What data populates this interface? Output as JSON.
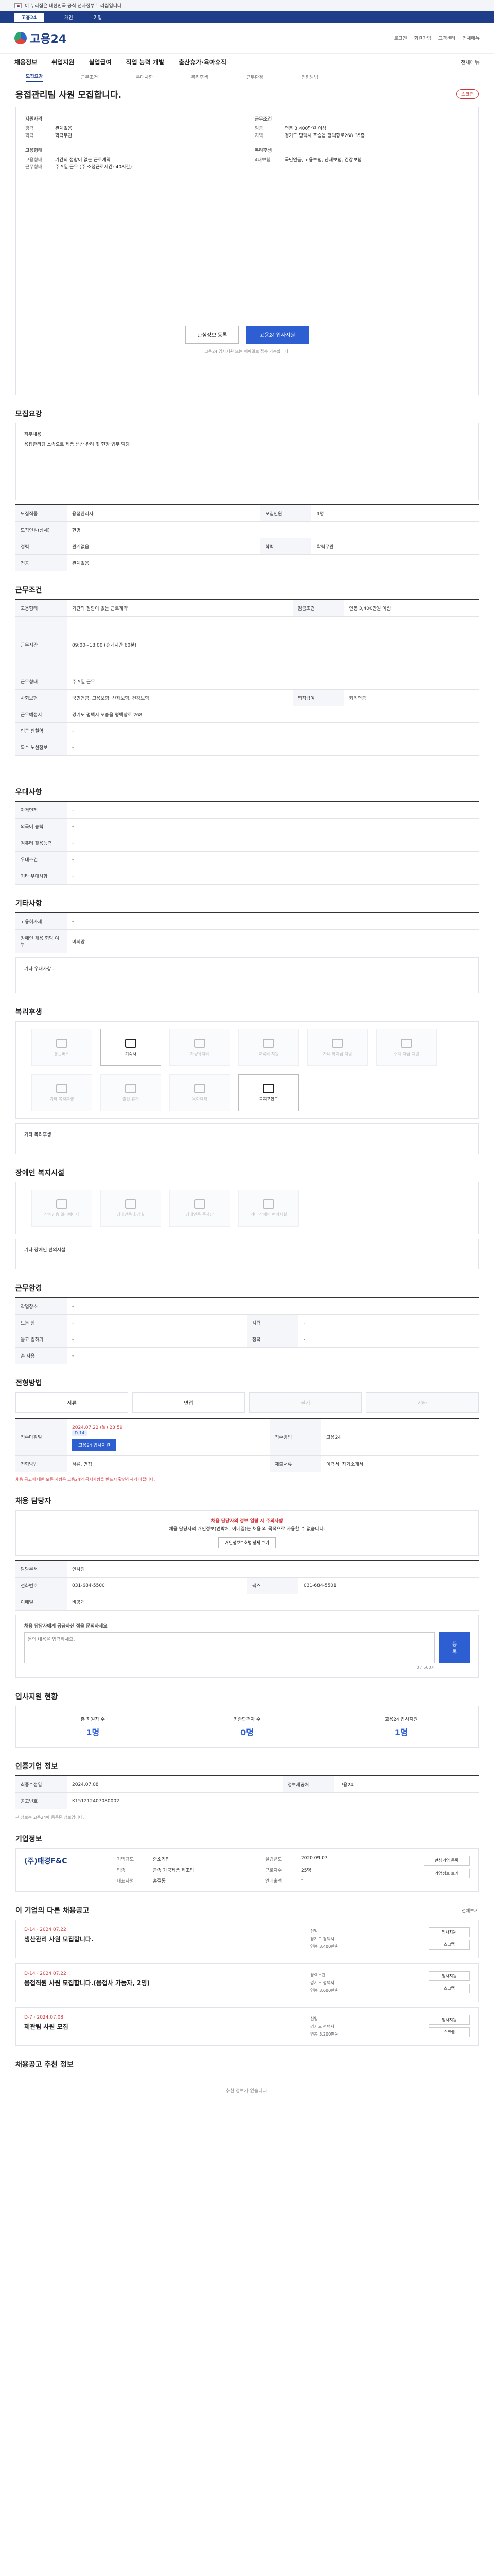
{
  "gov_banner": {
    "text": "이 누리집은 대한민국 공식 전자정부 누리집입니다."
  },
  "site_tabs": [
    "고용24",
    "개인",
    "기업"
  ],
  "header": {
    "logo": "고용24",
    "links": [
      "로그인",
      "회원가입",
      "고객센터",
      "전체메뉴"
    ]
  },
  "gnb": {
    "items": [
      "채용정보",
      "취업지원",
      "실업급여",
      "직업 능력 개발",
      "출산휴가·육아휴직"
    ],
    "right": "전체메뉴"
  },
  "subnav": {
    "items": [
      "모집요강",
      "근무조건",
      "우대사항",
      "복리후생",
      "근무환경",
      "전형방법"
    ],
    "active": 0
  },
  "job": {
    "title": "용접관리팀 사원 모집합니다.",
    "scrap": "스크랩",
    "company_h": "지원자격",
    "left": [
      [
        "경력",
        "관계없음"
      ],
      [
        "학력",
        "학력무관"
      ]
    ],
    "company_right_h": "근무조건",
    "right": [
      [
        "임금",
        "연봉 3,400만원 이상"
      ],
      [
        "지역",
        "경기도 평택시 포승읍 평택항로268 35층"
      ]
    ],
    "emp_h": "고용형태",
    "emp": [
      [
        "고용형태",
        "기간의 정함이 없는 근로계약"
      ],
      [
        "근무형태",
        "주 5일 근무 (주 소정근로시간: 40시간)"
      ]
    ],
    "benefits_h": "복리후생",
    "benefits": [
      [
        "4대보험",
        "국민연금, 고용보험, 산재보험, 건강보험"
      ]
    ],
    "btn_scrap": "관심정보 등록",
    "btn_apply": "고용24 입사지원",
    "note": "고용24 입사지원 또는 이메일로 접수 가능합니다."
  },
  "recruit": {
    "title": "모집요강",
    "duty_h": "직무내용",
    "duty": "용접관리팀 소속으로 제품 생산 관리 및 현장 업무 담당",
    "rows": [
      [
        "모집직종",
        "용접관리자"
      ],
      [
        "모집인원",
        "1명"
      ],
      [
        "모집인원(상세)",
        "한명"
      ],
      [
        "경력",
        "관계없음"
      ],
      [
        "학력",
        "학력무관"
      ],
      [
        "전공",
        "관계없음"
      ]
    ]
  },
  "work": {
    "title": "근무조건",
    "rows": [
      [
        "고용형태",
        "기간의 정함이 없는 근로계약"
      ],
      [
        "임금조건",
        "연봉 3,400만원 이상"
      ],
      [
        "근무시간",
        "주 소정근로시간 40시간"
      ],
      [
        "근무형태",
        "주 5일 근무"
      ],
      [
        "사회보험",
        "국민연금, 고용보험, 산재보험, 건강보험"
      ],
      [
        "퇴직급여",
        "퇴직연금"
      ],
      [
        "근무예정지",
        "경기도 평택시 포승읍 평택항로 268"
      ],
      [
        "인근 전철역",
        "-"
      ],
      [
        "복수 노선정보",
        "-"
      ]
    ],
    "detail": "09:00~18:00 (휴게시간 60분)"
  },
  "prefer": {
    "title": "우대사항",
    "rows": [
      [
        "자격면허",
        "-"
      ],
      [
        "외국어 능력",
        "-"
      ],
      [
        "컴퓨터 활용능력",
        "-"
      ],
      [
        "우대조건",
        "-"
      ],
      [
        "기타 우대사항",
        "-"
      ]
    ]
  },
  "skills": {
    "title": "기타사항",
    "rows": [
      [
        "고용허가제",
        "-"
      ],
      [
        "장애인 채용 희망 여부",
        "비희망"
      ]
    ],
    "note": "기타 우대사항 -"
  },
  "welfare": {
    "title": "복리후생",
    "tiles": [
      "통근버스",
      "기숙사",
      "차량유지비",
      "교육비 지원",
      "자녀 학자금 지원",
      "주택 자금 지원",
      "기타 복리후생",
      "출산 휴가",
      "육아휴직",
      "복지포인트"
    ],
    "active": [
      1,
      9
    ],
    "extra_h": "기타 복리후생"
  },
  "disabled": {
    "title": "장애인 복지시설",
    "tiles": [
      "장애인용 엘리베이터",
      "장애인용 화장실",
      "장애인용 주차장",
      "기타 장애인 편의시설"
    ],
    "extra_h": "기타 장애인 편의시설"
  },
  "env": {
    "title": "근무환경",
    "rows": [
      [
        "작업장소",
        "-"
      ],
      [
        "드는 힘",
        "-"
      ],
      [
        "들고 일하기",
        "-"
      ],
      [
        "손 사용",
        "-"
      ],
      [
        "시력",
        "-"
      ],
      [
        "청력",
        "-"
      ]
    ]
  },
  "process": {
    "title": "전형방법",
    "steps": [
      "서류",
      "면접",
      "필기",
      "기타"
    ],
    "active": [
      0,
      1
    ],
    "rows": [
      [
        "접수마감일",
        "2024.07.22 (월) 23:59"
      ],
      [
        "접수방법",
        "고용24"
      ],
      [
        "전형방법",
        "서류, 면접"
      ],
      [
        "제출서류",
        "이력서, 자기소개서"
      ]
    ],
    "deadline_badge": "D-14",
    "apply_btn": "고용24 입사지원",
    "note": "채용 공고에 대한 모든 사항은 고용24의 공지사항을 반드시 확인하시기 바랍니다."
  },
  "manager": {
    "title": "채용 담당자",
    "alert_head": "채용 담당자의 정보 열람 시 주의사항",
    "alert_body": "채용 담당자의 개인정보(연락처, 이메일)는 채용 외 목적으로 사용할 수 없습니다.",
    "alert_btn": "개인정보보호법 상세 보기",
    "rows": [
      [
        "담당부서",
        "인사팀"
      ],
      [
        "전화번호",
        "031-684-5500"
      ],
      [
        "팩스",
        "031-684-5501"
      ],
      [
        "이메일",
        "비공개"
      ]
    ],
    "inquiry_h": "채용 담당자에게 궁금하신 점을 문의하세요",
    "inquiry_placeholder": "문의 내용을 입력하세요.",
    "inquiry_btn": "등록",
    "inquiry_count": "0 / 500자"
  },
  "status": {
    "title": "입사지원 현황",
    "stats": [
      [
        "총 지원자 수",
        "1명"
      ],
      [
        "최종합격자 수",
        "0명"
      ],
      [
        "고용24 입사지원",
        "1명"
      ]
    ]
  },
  "info": {
    "title": "인증기업 정보",
    "rows": [
      [
        "최종수정일",
        "2024.07.08"
      ],
      [
        "공고번호",
        "K151212407080002"
      ],
      [
        "정보제공처",
        "고용24"
      ]
    ],
    "note": "본 정보는 고용24에 등록된 정보입니다."
  },
  "company": {
    "title": "기업정보",
    "name": "(주)태경F&C",
    "rows": [
      [
        "기업규모",
        "중소기업"
      ],
      [
        "업종",
        "금속 가공제품 제조업"
      ],
      [
        "대표자명",
        "홍길동"
      ],
      [
        "설립년도",
        "2020.09.07"
      ],
      [
        "근로자수",
        "25명"
      ],
      [
        "연매출액",
        "-"
      ]
    ],
    "buttons": [
      "관심기업 등록",
      "기업정보 보기"
    ]
  },
  "others": {
    "title": "이 기업의 다른 채용공고",
    "more": "전체보기",
    "jobs": [
      {
        "dday": "D-14 · 2024.07.22",
        "title": "생산관리 사원 모집합니다.",
        "meta": [
          "신입",
          "경기도 평택시",
          "연봉 3,400만원"
        ],
        "btns": [
          "입사지원",
          "스크랩"
        ]
      },
      {
        "dday": "D-14 · 2024.07.22",
        "title": "용접직원 사원 모집합니다.(용접사 가능자, 2명)",
        "meta": [
          "경력무관",
          "경기도 평택시",
          "연봉 3,600만원"
        ],
        "btns": [
          "입사지원",
          "스크랩"
        ]
      },
      {
        "dday": "D-7 · 2024.07.08",
        "title": "제관팀 사원 모집",
        "meta": [
          "신입",
          "경기도 평택시",
          "연봉 3,200만원"
        ],
        "btns": [
          "입사지원",
          "스크랩"
        ]
      }
    ]
  },
  "recommend": {
    "title": "채용공고 추천 정보",
    "note": "추천 정보가 없습니다."
  }
}
